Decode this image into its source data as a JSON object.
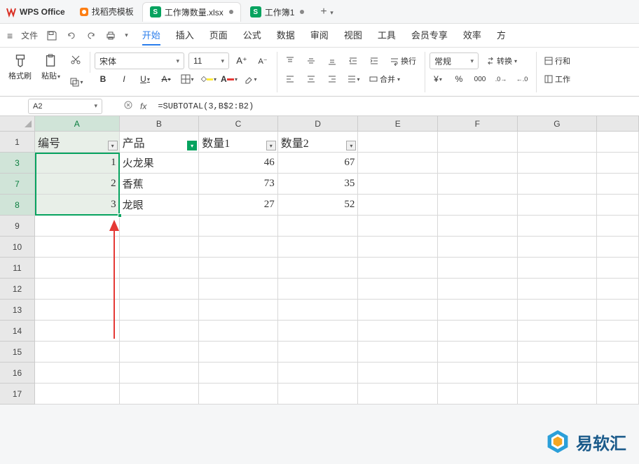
{
  "app": {
    "name": "WPS Office"
  },
  "tabs": {
    "t0": "找稻壳模板",
    "t1": "工作簿数量.xlsx",
    "t2": "工作簿1",
    "add": "+"
  },
  "menubar": {
    "file": "文件",
    "items": [
      "开始",
      "插入",
      "页面",
      "公式",
      "数据",
      "审阅",
      "视图",
      "工具",
      "会员专享",
      "效率",
      "方"
    ]
  },
  "toolbar": {
    "format_painter": "格式刷",
    "paste": "粘贴",
    "font": "宋体",
    "size": "11",
    "wrap": "换行",
    "merge": "合并",
    "normal": "常规",
    "convert": "转换",
    "row_col": "行和",
    "worksheet": "工作"
  },
  "fbar": {
    "cellref": "A2",
    "fx": "fx",
    "formula": "=SUBTOTAL(3,B$2:B2)"
  },
  "grid": {
    "cols": [
      "A",
      "B",
      "C",
      "D",
      "E",
      "F",
      "G",
      ""
    ],
    "row_labels": [
      "1",
      "3",
      "7",
      "8",
      "9",
      "10",
      "11",
      "12",
      "13",
      "14",
      "15",
      "16",
      "17"
    ],
    "headers": {
      "A": "编号",
      "B": "产品",
      "C": "数量1",
      "D": "数量2"
    },
    "data": [
      {
        "A": "1",
        "B": "火龙果",
        "C": "46",
        "D": "67"
      },
      {
        "A": "2",
        "B": "香蕉",
        "C": "73",
        "D": "35"
      },
      {
        "A": "3",
        "B": "龙眼",
        "C": "27",
        "D": "52"
      }
    ]
  },
  "watermark": "易软汇"
}
